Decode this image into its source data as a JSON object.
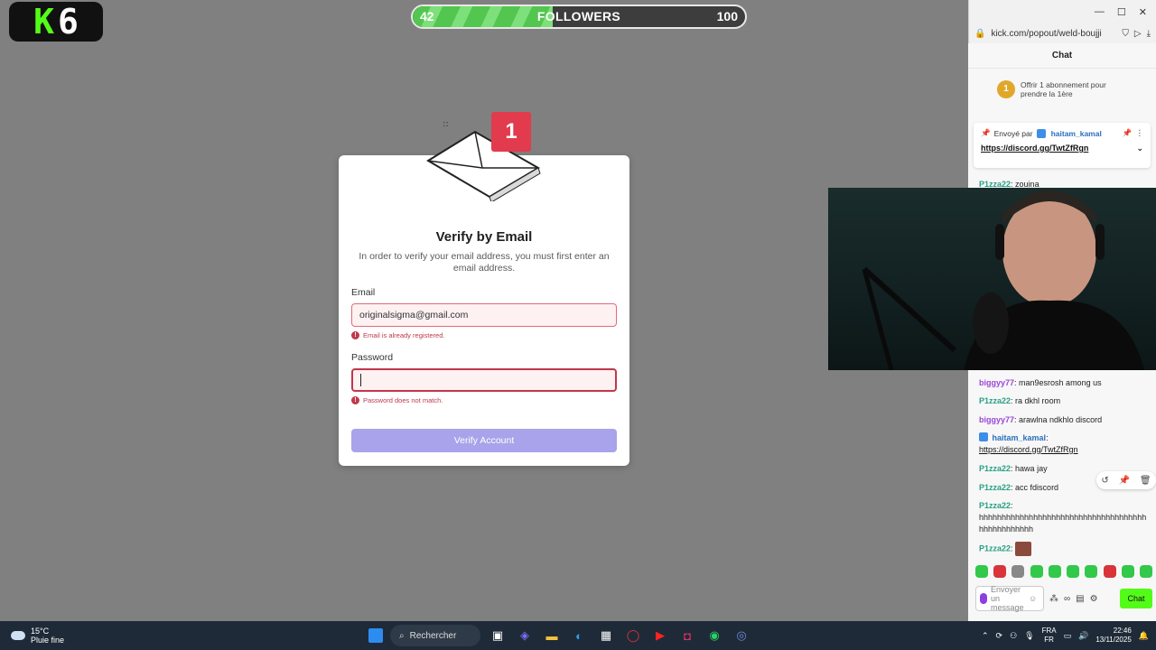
{
  "overlay": {
    "logo_left": "K",
    "logo_right": "6",
    "followers": {
      "current": "42",
      "label": "FOLLOWERS",
      "goal": "100",
      "progress": 0.42
    }
  },
  "verify_modal": {
    "badge_count": "1",
    "title": "Verify by Email",
    "description": "In order to verify your email address, you must first enter an email address.",
    "email_label": "Email",
    "email_value": "originalsigma@gmail.com",
    "email_error": "Email is already registered.",
    "password_label": "Password",
    "password_value": "",
    "password_error": "Password does not match.",
    "submit_label": "Verify Account"
  },
  "browser": {
    "url": "kick.com/popout/weld-boujji",
    "window_controls": [
      "minimize",
      "maximize",
      "close"
    ]
  },
  "chat": {
    "title": "Chat",
    "sub_offer": {
      "medal": "1",
      "text": "Offrir 1 abonnement pour prendre la 1ère"
    },
    "pinned": {
      "sent_by": "Envoyé par",
      "user": "haitam_kamal",
      "link": "https://discord.gg/TwtZfRgn"
    },
    "messages": [
      {
        "user": "P1zza22",
        "text": "zouina"
      },
      {
        "user": "biggyy77",
        "text": "man9esrosh among us"
      },
      {
        "user": "P1zza22",
        "text": "ra dkhl room"
      },
      {
        "user": "biggyy77",
        "text": "arawlna ndkhlo discord"
      },
      {
        "user": "haitam_kamal",
        "text": "https://discord.gg/TwtZfRgn"
      },
      {
        "user": "P1zza22",
        "text": "hawa jay"
      },
      {
        "user": "P1zza22",
        "text": "acc fdiscord"
      },
      {
        "user": "P1zza22",
        "text": "hhhhhhhhhhhhhhhhhhhhhhhhhhhhhhhhhhhhhhhhhhhhhhhhh"
      },
      {
        "user": "P1zza22",
        "text": ""
      }
    ],
    "input_placeholder": "Envoyer un message",
    "send_label": "Chat"
  },
  "taskbar": {
    "weather_temp": "15°C",
    "weather_desc": "Pluie fine",
    "search_label": "Rechercher",
    "lang_top": "FRA",
    "lang_bottom": "FR",
    "time": "22:46",
    "date": "13/11/2025"
  }
}
